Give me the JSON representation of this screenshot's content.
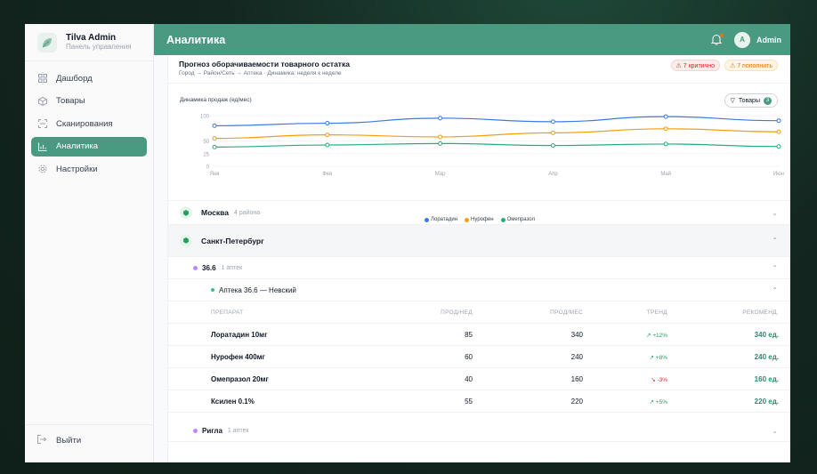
{
  "brand": {
    "name": "Tilva Admin",
    "subtitle": "Панель управления"
  },
  "nav": [
    {
      "label": "Дашборд",
      "icon": "grid-icon"
    },
    {
      "label": "Товары",
      "icon": "box-icon"
    },
    {
      "label": "Сканирования",
      "icon": "scan-icon"
    },
    {
      "label": "Аналитика",
      "icon": "chart-icon",
      "active": true
    },
    {
      "label": "Настройки",
      "icon": "gear-icon"
    }
  ],
  "logout": "Выйти",
  "header": {
    "title": "Аналитика",
    "user_initial": "A",
    "user_name": "Admin"
  },
  "forecast": {
    "title": "Прогноз оборачиваемости товарного остатка",
    "subtitle": "Город → Район/Сеть → Аптека · Динамика: неделя к неделе",
    "badge_critical": "⚠ 7 критично",
    "badge_refill": "⚠ 7 пополнить"
  },
  "chart_label": "Динамика продаж (ед/мес)",
  "filter": {
    "label": "Товары",
    "count": "3"
  },
  "chart_data": {
    "type": "line",
    "x": [
      "Янв",
      "Фев",
      "Мар",
      "Апр",
      "Май",
      "Июн"
    ],
    "yticks": [
      "0",
      "25",
      "50",
      "100"
    ],
    "series": [
      {
        "name": "Лоратадин",
        "color": "#3b7be8",
        "values": [
          80,
          85,
          95,
          88,
          98,
          90
        ]
      },
      {
        "name": "Нурофен",
        "color": "#f59e0b",
        "values": [
          55,
          62,
          58,
          66,
          74,
          68
        ]
      },
      {
        "name": "Омепразол",
        "color": "#22b07a",
        "values": [
          38,
          42,
          45,
          41,
          44,
          39
        ]
      }
    ]
  },
  "cities": [
    {
      "name": "Москва",
      "meta": "4 района",
      "chev": "⌄"
    },
    {
      "name": "Санкт-Петербург",
      "chev": "⌃"
    }
  ],
  "network": {
    "name": "36.6",
    "meta": "1 аптек",
    "chev": "⌃"
  },
  "pharmacy": {
    "name": "Аптека 36.6 — Невский",
    "chev": "⌃"
  },
  "table": {
    "headers": [
      "ПРЕПАРАТ",
      "ПРОД/НЕД",
      "ПРОД/МЕС",
      "ТРЕНД",
      "РЕКОМЕНД."
    ],
    "rows": [
      {
        "drug": "Лоратадин 10мг",
        "week": "85",
        "month": "340",
        "trend": "↗ +12%",
        "rec": "340 ед."
      },
      {
        "drug": "Нурофен 400мг",
        "week": "60",
        "month": "240",
        "trend": "↗ +8%",
        "rec": "240 ед."
      },
      {
        "drug": "Омепразол 20мг",
        "week": "40",
        "month": "160",
        "trend": "↘ -3%",
        "rec": "160 ед."
      },
      {
        "drug": "Ксилен 0.1%",
        "week": "55",
        "month": "220",
        "trend": "↗ +5%",
        "rec": "220 ед."
      }
    ]
  },
  "network2": {
    "name": "Ригла",
    "meta": "1 аптек",
    "chev": "⌄"
  }
}
